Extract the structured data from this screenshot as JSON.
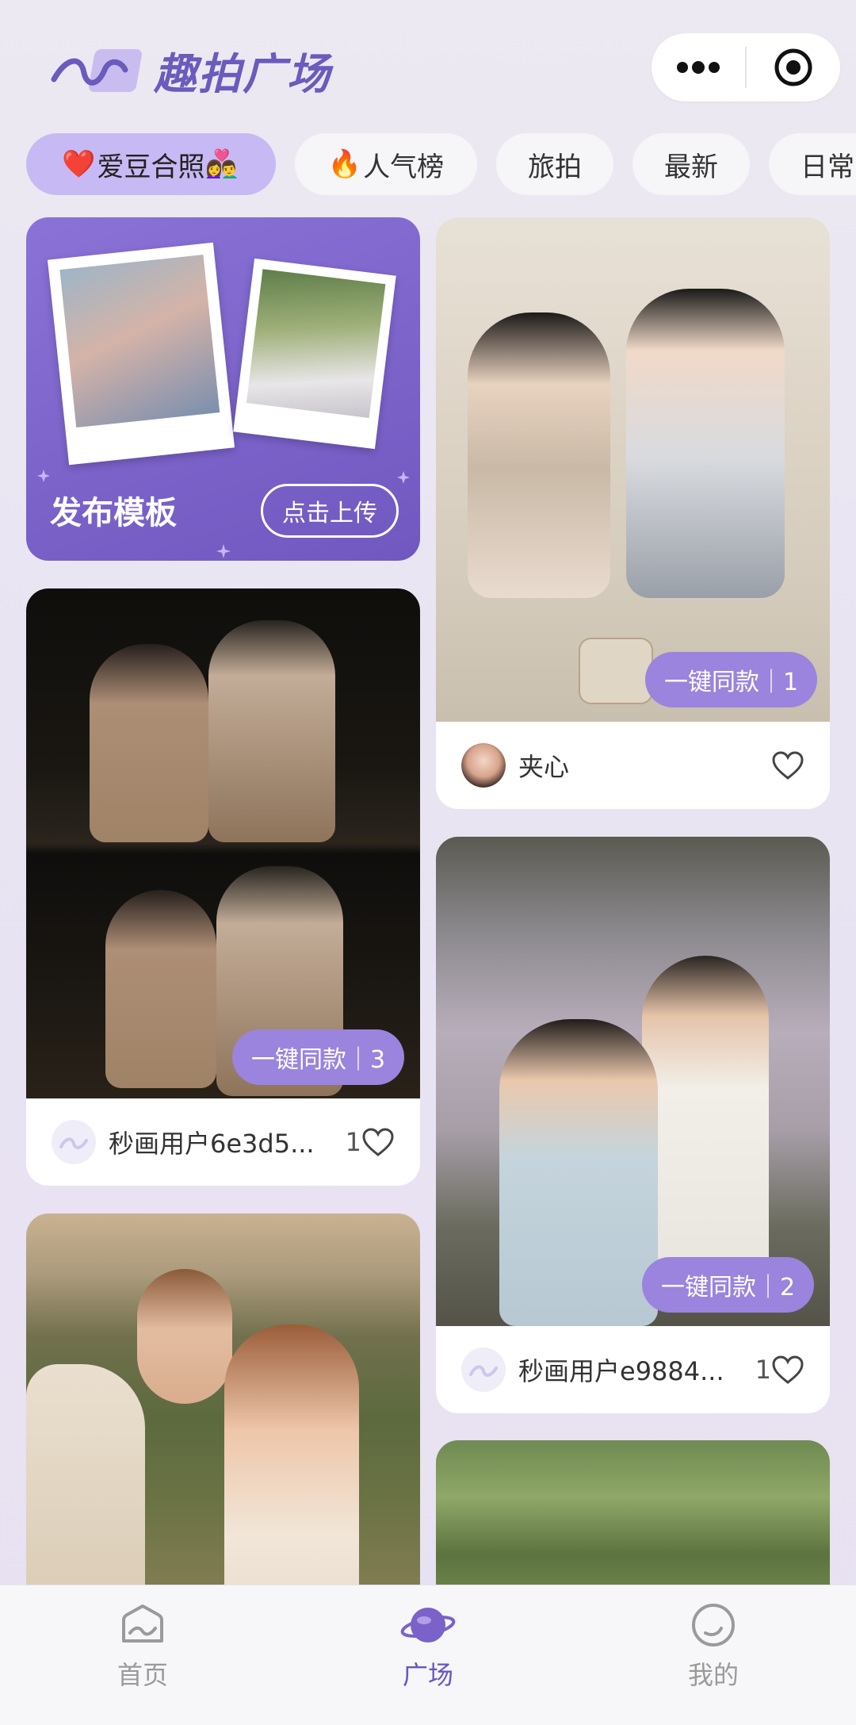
{
  "header": {
    "title": "趣拍广场",
    "capsule": {
      "more_icon": "more-dots-icon",
      "target_icon": "target-icon"
    }
  },
  "tabs": [
    {
      "label": "爱豆合照",
      "emoji_before": "❤️",
      "emoji_after": "👩‍❤️‍👨",
      "active": true
    },
    {
      "label": "人气榜",
      "emoji_before": "🔥",
      "active": false
    },
    {
      "label": "旅拍",
      "active": false
    },
    {
      "label": "最新",
      "active": false
    },
    {
      "label": "日常",
      "active": false
    }
  ],
  "publish_card": {
    "title": "发布模板",
    "button": "点击上传"
  },
  "posts": [
    {
      "user": "秒画用户6e3d5...",
      "likes": "1",
      "same_label": "一键同款｜3"
    },
    {
      "user": "夹心",
      "likes": "",
      "same_label": "一键同款｜1"
    },
    {
      "user": "秒画用户e9884...",
      "likes": "1",
      "same_label": "一键同款｜2"
    }
  ],
  "nav": [
    {
      "label": "首页",
      "icon": "home-icon",
      "active": false
    },
    {
      "label": "广场",
      "icon": "planet-icon",
      "active": true
    },
    {
      "label": "我的",
      "icon": "profile-icon",
      "active": false
    }
  ],
  "colors": {
    "accent": "#7a62c9",
    "active_tab": "#c7b9f3",
    "same_button": "#9a84dd"
  }
}
